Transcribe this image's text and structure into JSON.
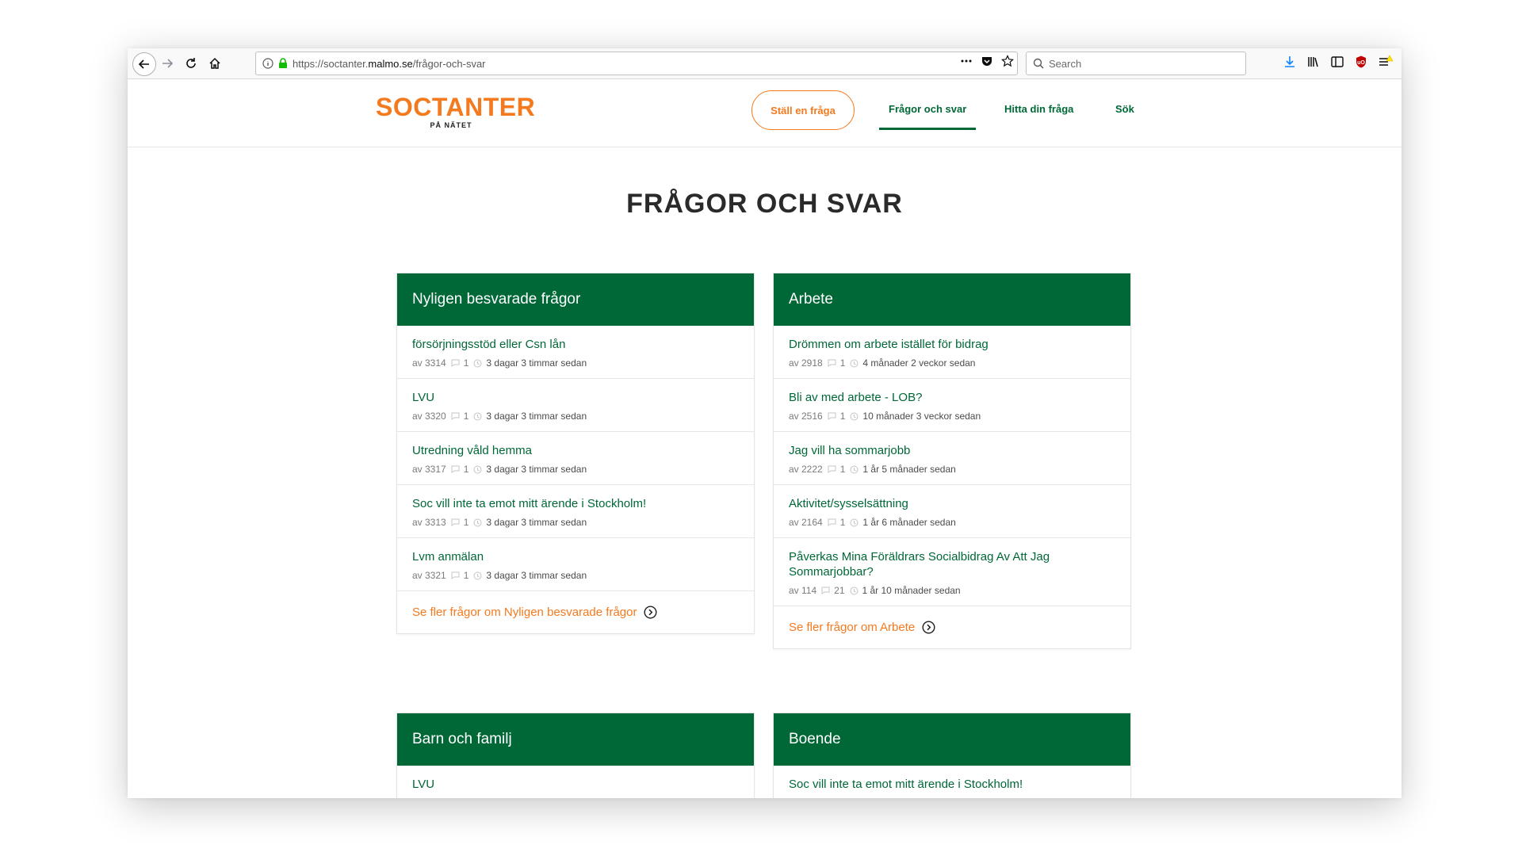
{
  "browser": {
    "url_prefix": "https://soctanter.",
    "url_host": "malmo.se",
    "url_path": "/frågor-och-svar",
    "search_placeholder": "Search"
  },
  "site": {
    "logo_main": "SOCTANTER",
    "logo_sub": "PÅ NÄTET",
    "ask_button": "Ställ en fråga",
    "nav": [
      "Frågor och svar",
      "Hitta din fråga",
      "Sök"
    ],
    "page_title": "FRÅGOR OCH SVAR"
  },
  "cards": [
    {
      "title": "Nyligen besvarade frågor",
      "questions": [
        {
          "title": "försörjningsstöd eller Csn lån",
          "author": "av 3314",
          "replies": "1",
          "time": "3 dagar 3 timmar sedan"
        },
        {
          "title": "LVU",
          "author": "av 3320",
          "replies": "1",
          "time": "3 dagar 3 timmar sedan"
        },
        {
          "title": "Utredning våld hemma",
          "author": "av 3317",
          "replies": "1",
          "time": "3 dagar 3 timmar sedan"
        },
        {
          "title": "Soc vill inte ta emot mitt ärende i Stockholm!",
          "author": "av 3313",
          "replies": "1",
          "time": "3 dagar 3 timmar sedan"
        },
        {
          "title": "Lvm anmälan",
          "author": "av 3321",
          "replies": "1",
          "time": "3 dagar 3 timmar sedan"
        }
      ],
      "see_more": "Se fler frågor om Nyligen besvarade frågor"
    },
    {
      "title": "Arbete",
      "questions": [
        {
          "title": "Drömmen om arbete istället för bidrag",
          "author": "av 2918",
          "replies": "1",
          "time": "4 månader 2 veckor sedan"
        },
        {
          "title": "Bli av med arbete - LOB?",
          "author": "av 2516",
          "replies": "1",
          "time": "10 månader 3 veckor sedan"
        },
        {
          "title": "Jag vill ha sommarjobb",
          "author": "av 2222",
          "replies": "1",
          "time": "1 år 5 månader sedan"
        },
        {
          "title": "Aktivitet/sysselsättning",
          "author": "av 2164",
          "replies": "1",
          "time": "1 år 6 månader sedan"
        },
        {
          "title": "Påverkas Mina Föräldrars Socialbidrag Av Att Jag Sommarjobbar?",
          "author": "av 114",
          "replies": "21",
          "time": "1 år 10 månader sedan"
        }
      ],
      "see_more": "Se fler frågor om Arbete"
    },
    {
      "title": "Barn och familj",
      "questions": [
        {
          "title": "LVU"
        }
      ]
    },
    {
      "title": "Boende",
      "questions": [
        {
          "title": "Soc vill inte ta emot mitt ärende i Stockholm!"
        }
      ]
    }
  ],
  "colors": {
    "brand_orange": "#f47a1f",
    "brand_green": "#006837"
  }
}
